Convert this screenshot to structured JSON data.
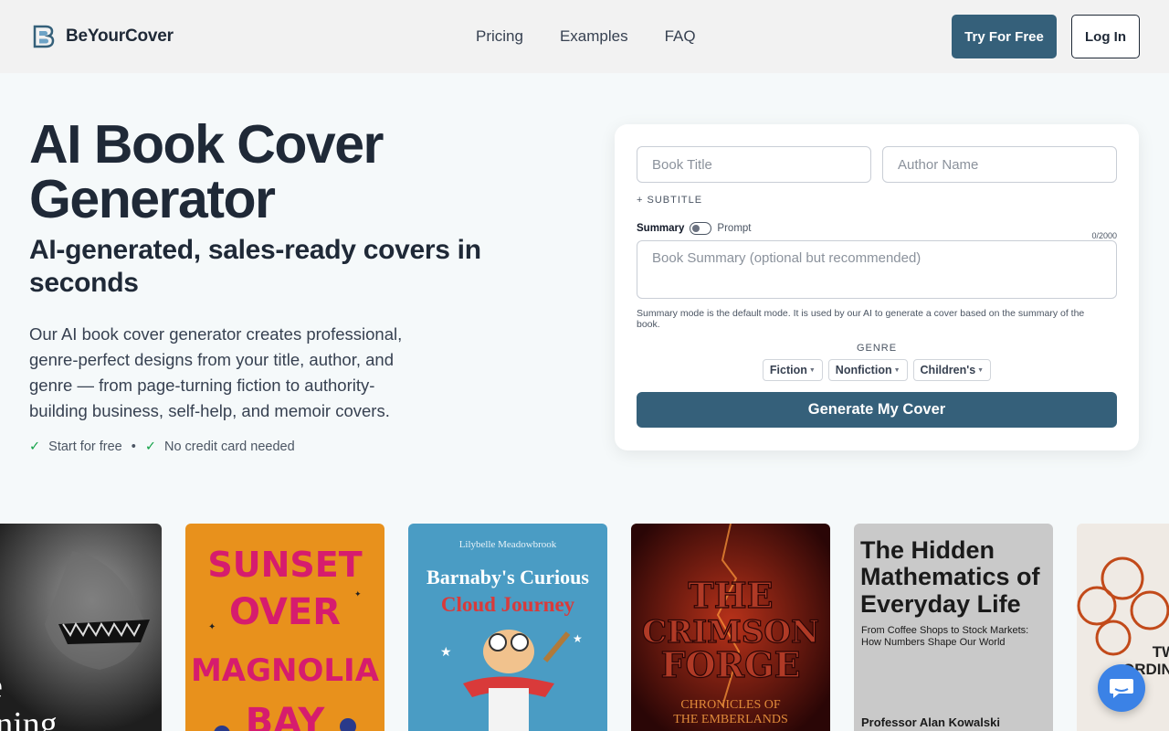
{
  "nav": {
    "brand": "BeYourCover",
    "links": [
      "Pricing",
      "Examples",
      "FAQ"
    ],
    "try_label": "Try For Free",
    "login_label": "Log In"
  },
  "hero": {
    "title": "AI Book Cover Generator",
    "subtitle": "AI-generated, sales-ready covers in seconds",
    "description": "Our AI book cover generator creates professional, genre-perfect designs from your title, author, and genre — from page-turning fiction to authority-building business, self-help, and memoir covers.",
    "checks": [
      "Start for free",
      "No credit card needed"
    ]
  },
  "form": {
    "title_placeholder": "Book Title",
    "author_placeholder": "Author Name",
    "subtitle_link": "+ SUBTITLE",
    "mode_summary": "Summary",
    "mode_prompt": "Prompt",
    "counter": "0/2000",
    "summary_placeholder": "Book Summary (optional but recommended)",
    "help_text": "Summary mode is the default mode. It is used by our AI to generate a cover based on the summary of the book.",
    "genre_label": "GENRE",
    "genres": [
      "Fiction",
      "Nonfiction",
      "Children's"
    ],
    "generate_label": "Generate My Cover"
  },
  "covers": [
    {
      "lines": [
        "he",
        "rinning"
      ],
      "colors": {
        "bg": "#2a2a2a"
      }
    },
    {
      "lines": [
        "SUNSET",
        "OVER",
        "MAGNOLIA",
        "BAY"
      ],
      "colors": {
        "bg": "#e8911c",
        "text": "#d61c6e"
      }
    },
    {
      "author": "Lilybelle Meadowbrook",
      "lines": [
        "Barnaby's Curious",
        "Cloud Journey"
      ],
      "colors": {
        "bg": "#4a9cc4"
      }
    },
    {
      "lines": [
        "THE",
        "CRIMSON",
        "FORGE"
      ],
      "series": [
        "CHRONICLES OF",
        "THE EMBERLANDS"
      ],
      "colors": {
        "bg": "#4a1010"
      }
    },
    {
      "lines": [
        "The Hidden",
        "Mathematics of",
        "Everyday Life"
      ],
      "tagline": [
        "From Coffee Shops to Stock Markets:",
        "How Numbers Shape Our World"
      ],
      "author": "Professor Alan Kowalski",
      "colors": {
        "bg": "#c9c9c9"
      }
    },
    {
      "lines": [
        "TW",
        "ORDINA"
      ],
      "colors": {
        "bg": "#efeae4"
      }
    }
  ],
  "icons": {
    "logo": "logo-b-icon",
    "check": "check-icon",
    "chevron": "chevron-down-icon",
    "chat": "chat-icon"
  }
}
